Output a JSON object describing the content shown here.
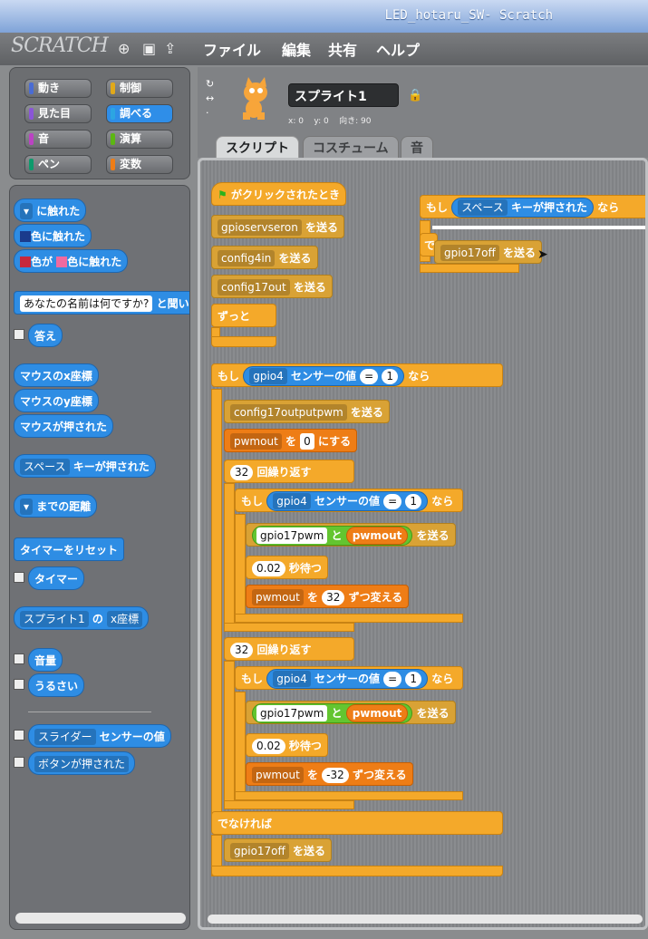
{
  "window": {
    "title": "LED_hotaru_SW- Scratch"
  },
  "menu": {
    "logo": "SCRATCH",
    "items": [
      "ファイル",
      "編集",
      "共有",
      "ヘルプ"
    ]
  },
  "categories": [
    {
      "label": "動き",
      "color": "#4a6cd4"
    },
    {
      "label": "制御",
      "color": "#e1a91a"
    },
    {
      "label": "見た目",
      "color": "#8a55d7"
    },
    {
      "label": "調べる",
      "color": "#2ca5e2"
    },
    {
      "label": "音",
      "color": "#bb42c3"
    },
    {
      "label": "演算",
      "color": "#5cb712"
    },
    {
      "label": "ペン",
      "color": "#0e9a6c"
    },
    {
      "label": "変数",
      "color": "#ee7d16"
    }
  ],
  "palette": {
    "touching": "に触れた",
    "touching_color": "色に触れた",
    "color_a": "色が",
    "color_b": "色に触れた",
    "ask_default": "あなたの名前は何ですか?",
    "ask_suffix": "と聞い",
    "answer": "答え",
    "mouse_x": "マウスのx座標",
    "mouse_y": "マウスのy座標",
    "mouse_down": "マウスが押された",
    "key_space": "スペース",
    "key_pressed": "キーが押された",
    "distance_to": "までの距離",
    "reset_timer": "タイマーをリセット",
    "timer": "タイマー",
    "sprite_of": "スプライト1",
    "of_label": "の",
    "x_pos": "x座標",
    "loudness": "音量",
    "loud": "うるさい",
    "slider": "スライダー",
    "sensor_value": "センサーの値",
    "button_pressed": "ボタンが押された"
  },
  "sprite": {
    "name": "スプライト1",
    "x_label": "x: 0",
    "y_label": "y: 0",
    "dir_label": "向き: 90"
  },
  "tabs": [
    "スクリプト",
    "コスチューム",
    "音"
  ],
  "script": {
    "flag_clicked": "がクリックされたとき",
    "send": "を送る",
    "msg_servo": "gpioservseron",
    "msg_config4": "config4in",
    "msg_config17": "config17out",
    "forever": "ずっと",
    "if": "もし",
    "then": "なら",
    "else": "でなければ",
    "gpio4": "gpio4",
    "sensor_value": "センサーの値",
    "eq": "=",
    "one": "1",
    "msg_pwm": "config17outputpwm",
    "var_pwm": "pwmout",
    "to": "を",
    "zero": "0",
    "set_to": "にする",
    "repeat_n": "32",
    "repeat": "回繰り返す",
    "gpio17pwm": "gpio17pwm",
    "and": "と",
    "wait_val": "0.02",
    "wait": "秒待つ",
    "change_pos": "32",
    "change_neg": "-32",
    "change": "ずつ変える",
    "msg_off": "gpio17off",
    "key_space": "スペース",
    "key_pressed": "キーが押された",
    "else_partial": "で"
  }
}
